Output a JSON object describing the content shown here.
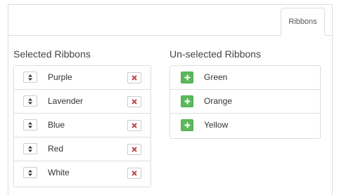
{
  "tabs": [
    {
      "label": "Ribbons"
    }
  ],
  "selected": {
    "heading": "Selected Ribbons",
    "items": [
      {
        "label": "Purple"
      },
      {
        "label": "Lavender"
      },
      {
        "label": "Blue"
      },
      {
        "label": "Red"
      },
      {
        "label": "White"
      }
    ]
  },
  "unselected": {
    "heading": "Un-selected Ribbons",
    "items": [
      {
        "label": "Green"
      },
      {
        "label": "Orange"
      },
      {
        "label": "Yellow"
      }
    ]
  },
  "icons": {
    "sort": "sort-icon",
    "remove": "remove-icon",
    "add": "plus-icon"
  },
  "colors": {
    "add_button": "#5cb85c",
    "remove_icon": "#b94a48",
    "border": "#dddddd"
  }
}
